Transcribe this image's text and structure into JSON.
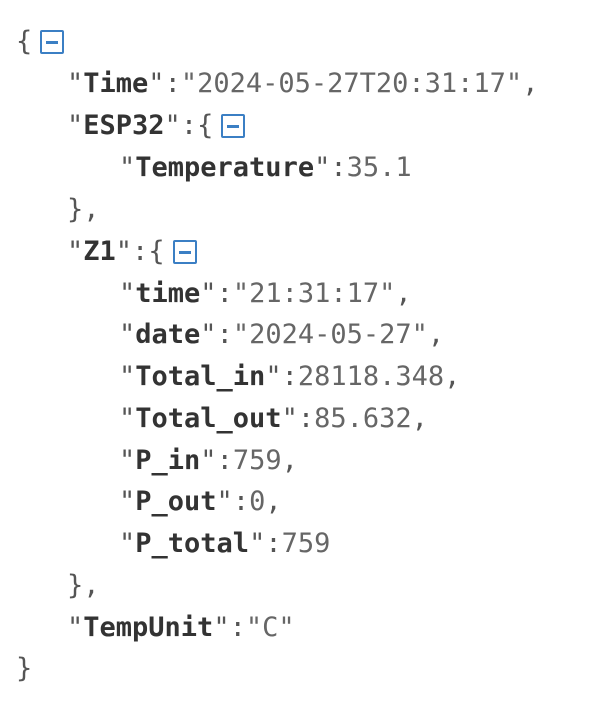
{
  "json": {
    "open_brace": "{",
    "close_brace": "}",
    "time": {
      "key": "Time",
      "value": "\"2024-05-27T20:31:17\"",
      "trail": ","
    },
    "esp32": {
      "key": "ESP32",
      "open": "{",
      "close": "},",
      "temperature": {
        "key": "Temperature",
        "value": "35.1"
      }
    },
    "z1": {
      "key": "Z1",
      "open": "{",
      "close": "},",
      "time": {
        "key": "time",
        "value": "\"21:31:17\"",
        "trail": ","
      },
      "date": {
        "key": "date",
        "value": "\"2024-05-27\"",
        "trail": ","
      },
      "total_in": {
        "key": "Total_in",
        "value": "28118.348",
        "trail": ","
      },
      "total_out": {
        "key": "Total_out",
        "value": "85.632",
        "trail": ","
      },
      "p_in": {
        "key": "P_in",
        "value": "759",
        "trail": ","
      },
      "p_out": {
        "key": "P_out",
        "value": "0",
        "trail": ","
      },
      "p_total": {
        "key": "P_total",
        "value": "759"
      }
    },
    "tempunit": {
      "key": "TempUnit",
      "value": "\"C\""
    }
  },
  "icons": {
    "collapse": "collapse-icon"
  },
  "colors": {
    "toggle": "#3b7fc4",
    "key": "#333333",
    "value": "#666666"
  }
}
